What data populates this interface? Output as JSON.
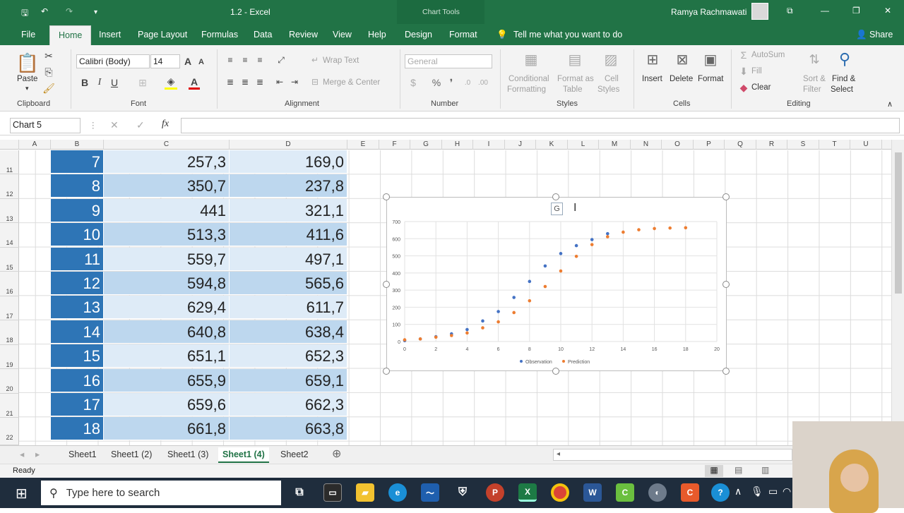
{
  "titlebar": {
    "doc_title": "1.2  -  Excel",
    "context_label": "Chart Tools",
    "user_name": "Ramya Rachmawati"
  },
  "tabs": [
    "File",
    "Home",
    "Insert",
    "Page Layout",
    "Formulas",
    "Data",
    "Review",
    "View",
    "Help",
    "Design",
    "Format"
  ],
  "tell_me": "Tell me what you want to do",
  "share": "Share",
  "ribbon": {
    "paste": "Paste",
    "clipboard": "Clipboard",
    "font_name": "Calibri (Body)",
    "font_size": "14",
    "font_group": "Font",
    "wrap_text": "Wrap Text",
    "merge_center": "Merge & Center",
    "alignment": "Alignment",
    "number_format": "General",
    "number": "Number",
    "cond_format_1": "Conditional",
    "cond_format_2": "Formatting",
    "format_table_1": "Format as",
    "format_table_2": "Table",
    "cell_styles_1": "Cell",
    "cell_styles_2": "Styles",
    "styles": "Styles",
    "insert": "Insert",
    "delete": "Delete",
    "format": "Format",
    "cells": "Cells",
    "autosum": "AutoSum",
    "fill": "Fill",
    "clear": "Clear",
    "sort_filter_1": "Sort &",
    "sort_filter_2": "Filter",
    "find_select_1": "Find &",
    "find_select_2": "Select",
    "editing": "Editing"
  },
  "formula_bar": {
    "name_box": "Chart 5",
    "fx": "fx",
    "content": ""
  },
  "columns": [
    "A",
    "B",
    "C",
    "D",
    "E",
    "F",
    "G",
    "H",
    "I",
    "J",
    "K",
    "L",
    "M",
    "N",
    "O",
    "P",
    "Q",
    "R",
    "S",
    "T",
    "U"
  ],
  "rows": [
    {
      "num": "11",
      "b": "7",
      "c": "257,3",
      "d": "169,0"
    },
    {
      "num": "12",
      "b": "8",
      "c": "350,7",
      "d": "237,8"
    },
    {
      "num": "13",
      "b": "9",
      "c": "441",
      "d": "321,1"
    },
    {
      "num": "14",
      "b": "10",
      "c": "513,3",
      "d": "411,6"
    },
    {
      "num": "15",
      "b": "11",
      "c": "559,7",
      "d": "497,1"
    },
    {
      "num": "16",
      "b": "12",
      "c": "594,8",
      "d": "565,6"
    },
    {
      "num": "17",
      "b": "13",
      "c": "629,4",
      "d": "611,7"
    },
    {
      "num": "18",
      "b": "14",
      "c": "640,8",
      "d": "638,4"
    },
    {
      "num": "19",
      "b": "15",
      "c": "651,1",
      "d": "652,3"
    },
    {
      "num": "20",
      "b": "16",
      "c": "655,9",
      "d": "659,1"
    },
    {
      "num": "21",
      "b": "17",
      "c": "659,6",
      "d": "662,3"
    },
    {
      "num": "22",
      "b": "18",
      "c": "661,8",
      "d": "663,8"
    }
  ],
  "chart_data": {
    "type": "scatter",
    "title": "",
    "xlim": [
      0,
      20
    ],
    "ylim": [
      0,
      700
    ],
    "x_ticks": [
      0,
      2,
      4,
      6,
      8,
      10,
      12,
      14,
      16,
      18,
      20
    ],
    "y_ticks": [
      0,
      100,
      200,
      300,
      400,
      500,
      600,
      700
    ],
    "grid": true,
    "legend": "bottom",
    "series": [
      {
        "name": "Observation",
        "color": "#4472c4",
        "x": [
          0,
          1,
          2,
          3,
          4,
          5,
          6,
          7,
          8,
          9,
          10,
          11,
          12,
          13
        ],
        "y": [
          5,
          15,
          28,
          45,
          70,
          120,
          175,
          257.3,
          350.7,
          441,
          513.3,
          559.7,
          594.8,
          629.4
        ]
      },
      {
        "name": "Prediction",
        "color": "#ed7d31",
        "x": [
          0,
          1,
          2,
          3,
          4,
          5,
          6,
          7,
          8,
          9,
          10,
          11,
          12,
          13,
          14,
          15,
          16,
          17,
          18
        ],
        "y": [
          10,
          15,
          25,
          35,
          50,
          80,
          115,
          169,
          237.8,
          321.1,
          411.6,
          497.1,
          565.6,
          611.7,
          638.4,
          652.3,
          659.1,
          662.3,
          663.8
        ]
      }
    ],
    "selected_title_placeholder": "G"
  },
  "sheets": [
    "Sheet1",
    "Sheet1 (2)",
    "Sheet1 (3)",
    "Sheet1 (4)",
    "Sheet2"
  ],
  "active_sheet": "Sheet1 (4)",
  "status": "Ready",
  "taskbar": {
    "search_placeholder": "Type here to search"
  }
}
